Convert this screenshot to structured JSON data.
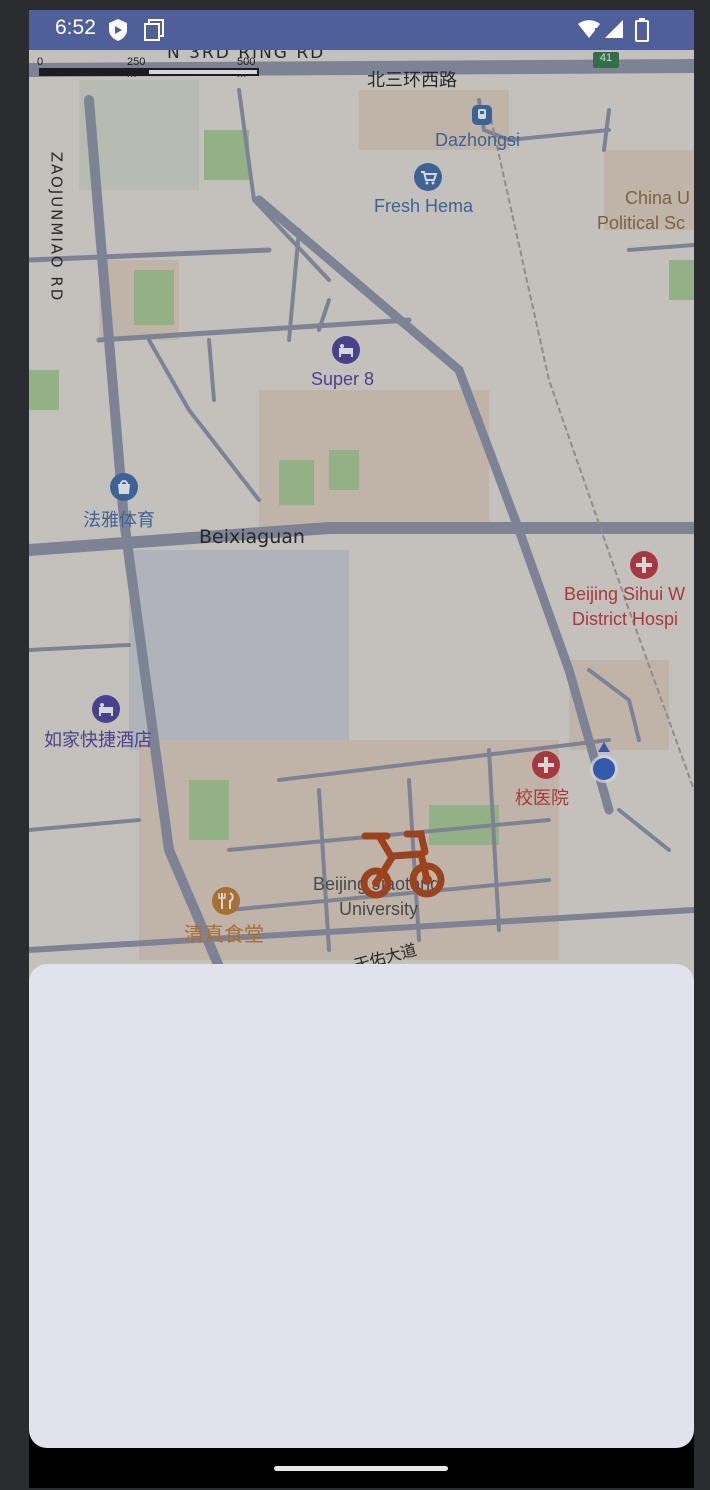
{
  "status": {
    "time": "6:52"
  },
  "map": {
    "scale": {
      "zero": "0",
      "mid": "250 m",
      "max": "500 m"
    },
    "roads": {
      "north_third_ring": "N 3RD RING RD",
      "beisanhuan_xilu": "北三环西路",
      "zaojunmiao_rd": "ZAOJUNMIAO RD",
      "tianyou_dadao": "天佑大道",
      "beixiaguan": "Beixiaguan",
      "highway_shield": "41"
    },
    "pois": {
      "dazhongsi": "Dazhongsi",
      "fresh_hema": "Fresh Hema",
      "china_u_line1": "China U",
      "china_u_line2": "Political Sc",
      "super8": "Super 8",
      "fayatiyu": "法雅体育",
      "sihui_line1": "Beijing Sihui W",
      "sihui_line2": "District Hospi",
      "rujia": "如家快捷酒店",
      "xiaoyiyuan": "校医院",
      "bjtu_line1": "Beijing Jiaotong",
      "bjtu_line2": "University",
      "qingzhen": "清真食堂"
    },
    "colors": {
      "transit": "#3c6aa8",
      "hotel": "#4b3f9e",
      "hospital": "#c4343a",
      "food": "#c47a2a",
      "bike": "#b5420f",
      "location": "#2e5fc6"
    }
  },
  "bottom_sheet": {}
}
